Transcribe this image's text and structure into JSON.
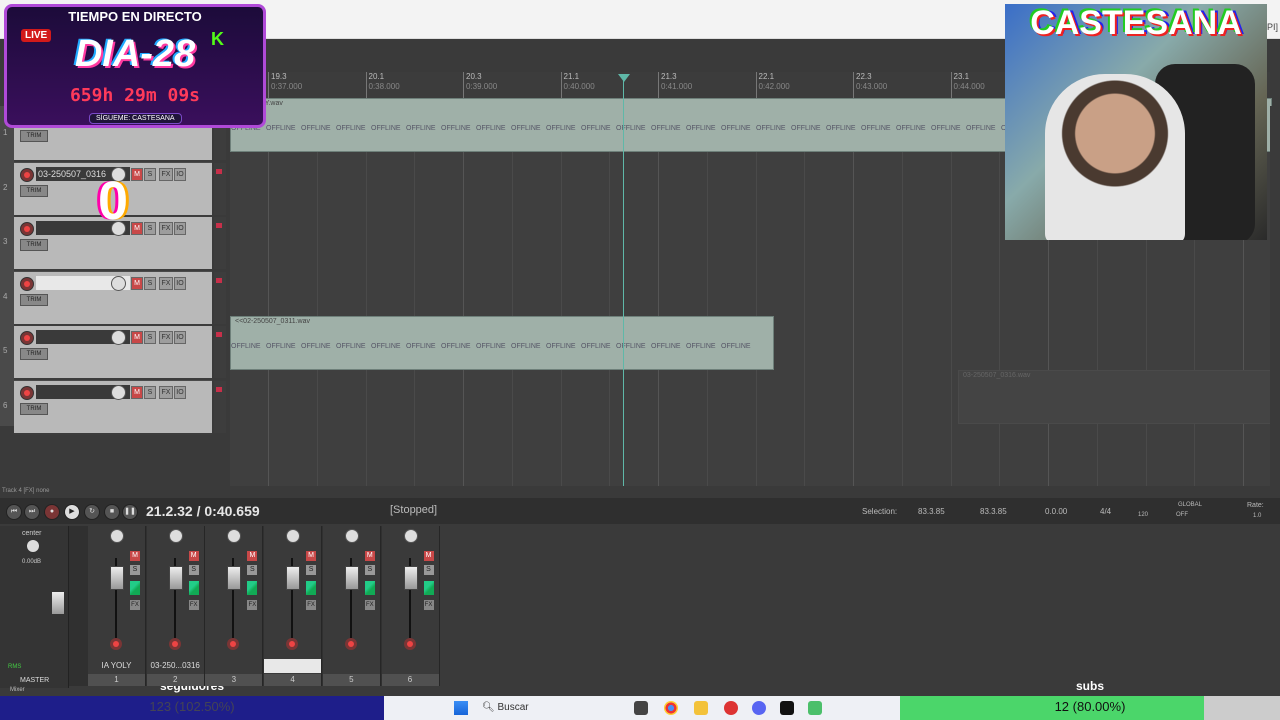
{
  "window": {
    "title_suffix": "SAPI]"
  },
  "ruler": {
    "marks": [
      {
        "bar": "19.3",
        "time": "0:37.000"
      },
      {
        "bar": "20.1",
        "time": "0:38.000"
      },
      {
        "bar": "20.3",
        "time": "0:39.000"
      },
      {
        "bar": "21.1",
        "time": "0:40.000"
      },
      {
        "bar": "21.3",
        "time": "0:41.000"
      },
      {
        "bar": "22.1",
        "time": "0:42.000"
      },
      {
        "bar": "22.3",
        "time": "0:43.000"
      },
      {
        "bar": "23.1",
        "time": "0:44.000"
      }
    ]
  },
  "tracks": [
    {
      "num": "1",
      "name": "",
      "item": "<<IA YOLY.wav"
    },
    {
      "num": "2",
      "name": "03-250507_0316"
    },
    {
      "num": "3",
      "name": ""
    },
    {
      "num": "4",
      "name": ""
    },
    {
      "num": "5",
      "name": "",
      "item": "<<02-250507_0311.wav"
    },
    {
      "num": "6",
      "name": "",
      "item": "03-250507_0316.wav"
    }
  ],
  "track_buttons": {
    "mute": "M",
    "solo": "S",
    "fx": "FX",
    "io": "IO",
    "trim": "TRIM"
  },
  "offline_label": "OFFLINE",
  "track_info": "Track 4 [FX] none",
  "transport": {
    "position": "21.2.32 / 0:40.659",
    "state": "[Stopped]",
    "selection_label": "Selection:",
    "sel_start": "83.3.85",
    "sel_end": "83.3.85",
    "sel_len": "0.0.00",
    "time_sig": "4/4",
    "bpm": "120",
    "global": "GLOBAL",
    "global_state": "OFF",
    "rate_label": "Rate:",
    "rate": "1.0"
  },
  "mixer": {
    "master_label": "MASTER",
    "master_pan": "center",
    "master_db": "0.00dB",
    "rms": "RMS",
    "inf": "-inf",
    "channels": [
      {
        "name": "IA YOLY",
        "no": "1"
      },
      {
        "name": "03-250...0316",
        "no": "2"
      },
      {
        "name": "",
        "no": "3"
      },
      {
        "name": "",
        "no": "4"
      },
      {
        "name": "",
        "no": "5"
      },
      {
        "name": "",
        "no": "6"
      }
    ],
    "mixer_tab": "Mixer"
  },
  "overlay": {
    "header": "TIEMPO EN DIRECTO",
    "live": "LIVE",
    "day": "DIA-28",
    "counter": "659h 29m 09s",
    "follow": "SÍGUEME: CASTESANA",
    "k": "K"
  },
  "webcam": {
    "logo": "CASTESANA"
  },
  "glitch_digit": "0",
  "goals": {
    "followers_label": "seguidores",
    "followers_value": "123 (102.50%)",
    "subs_label": "subs",
    "subs_value": "12 (80.00%)",
    "subs_fraction": 0.8
  },
  "taskbar": {
    "search": "Buscar"
  },
  "colors": {
    "accent": "#5fb8a8",
    "mute": "#c84848",
    "subs_fill": "#4bd66a",
    "followers_bar": "#1e1e8a"
  }
}
